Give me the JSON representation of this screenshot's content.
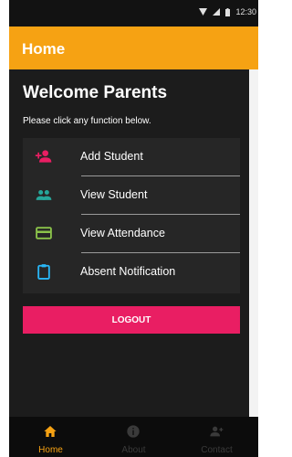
{
  "status_bar": {
    "time": "12:30"
  },
  "app_bar": {
    "title": "Home"
  },
  "welcome": {
    "title": "Welcome Parents",
    "instruction": "Please click any function below."
  },
  "menu": {
    "items": [
      {
        "label": "Add Student",
        "icon": "add-person-icon",
        "color": "#e91e63"
      },
      {
        "label": "View Student",
        "icon": "people-icon",
        "color": "#26a69a"
      },
      {
        "label": "View Attendance",
        "icon": "credit-card-icon",
        "color": "#8bc34a"
      },
      {
        "label": "Absent Notification",
        "icon": "clipboard-icon",
        "color": "#29b6f6"
      }
    ]
  },
  "logout": {
    "label": "LOGOUT",
    "color": "#e91e63"
  },
  "bottom_nav": {
    "active_color": "#f6a213",
    "inactive_color": "#3a3a3a",
    "items": [
      {
        "label": "Home",
        "icon": "home-icon",
        "active": true
      },
      {
        "label": "About",
        "icon": "info-icon",
        "active": false
      },
      {
        "label": "Contact",
        "icon": "contact-icon",
        "active": false
      }
    ]
  },
  "colors": {
    "app_bar": "#f6a213",
    "background": "#1c1c1c",
    "card": "#262626"
  }
}
